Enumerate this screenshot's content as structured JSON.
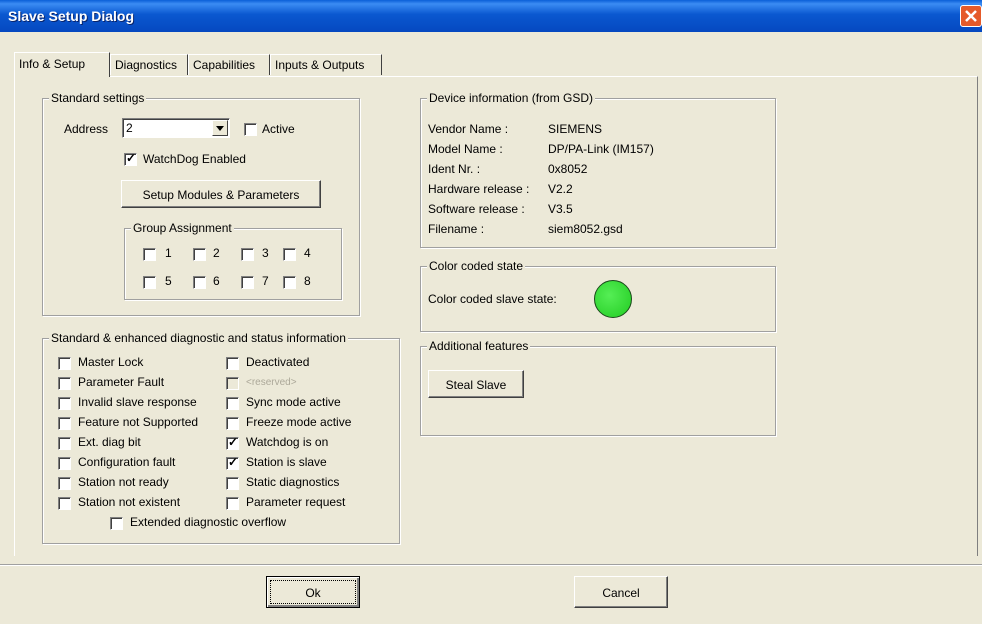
{
  "window": {
    "title": "Slave Setup Dialog",
    "close_label": "close"
  },
  "tabs": [
    {
      "label": "Info & Setup"
    },
    {
      "label": "Diagnostics"
    },
    {
      "label": "Capabilities"
    },
    {
      "label": "Inputs & Outputs"
    }
  ],
  "standard": {
    "legend": "Standard settings",
    "address_label": "Address",
    "address_value": "2",
    "active_label": "Active",
    "active_checked": false,
    "watchdog_label": "WatchDog Enabled",
    "watchdog_checked": true,
    "setup_button": "Setup Modules & Parameters",
    "group_legend": "Group Assignment",
    "groups": [
      "1",
      "2",
      "3",
      "4",
      "5",
      "6",
      "7",
      "8"
    ]
  },
  "diag": {
    "legend": "Standard & enhanced diagnostic and status information",
    "left": [
      {
        "label": "Master Lock",
        "checked": false
      },
      {
        "label": "Parameter Fault",
        "checked": false
      },
      {
        "label": "Invalid slave response",
        "checked": false
      },
      {
        "label": "Feature not Supported",
        "checked": false
      },
      {
        "label": "Ext. diag bit",
        "checked": false
      },
      {
        "label": "Configuration fault",
        "checked": false
      },
      {
        "label": "Station not ready",
        "checked": false
      },
      {
        "label": "Station not existent",
        "checked": false
      }
    ],
    "right": [
      {
        "label": "Deactivated",
        "checked": false
      },
      {
        "label": "<reserved>",
        "checked": false
      },
      {
        "label": "Sync mode active",
        "checked": false
      },
      {
        "label": "Freeze mode active",
        "checked": false
      },
      {
        "label": "Watchdog is on",
        "checked": true
      },
      {
        "label": "Station is slave",
        "checked": true
      },
      {
        "label": "Static diagnostics",
        "checked": false
      },
      {
        "label": "Parameter request",
        "checked": false
      }
    ],
    "overflow": {
      "label": "Extended diagnostic overflow",
      "checked": false
    }
  },
  "device": {
    "legend": "Device information (from GSD)",
    "rows": [
      {
        "key": "Vendor Name :",
        "value": "SIEMENS"
      },
      {
        "key": "Model Name :",
        "value": "DP/PA-Link (IM157)"
      },
      {
        "key": "Ident Nr. :",
        "value": "0x8052"
      },
      {
        "key": "Hardware release :",
        "value": "V2.2"
      },
      {
        "key": "Software release :",
        "value": "V3.5"
      },
      {
        "key": "Filename :",
        "value": "siem8052.gsd"
      }
    ]
  },
  "color_state": {
    "legend": "Color coded state",
    "label": "Color coded slave state:",
    "color": "#22cc22"
  },
  "features": {
    "legend": "Additional features",
    "steal_button": "Steal Slave"
  },
  "footer": {
    "ok": "Ok",
    "cancel": "Cancel"
  },
  "colors": {
    "titlebar": "#0a58d0",
    "dialog_bg": "#ece9d8",
    "close": "#e55a2a"
  }
}
